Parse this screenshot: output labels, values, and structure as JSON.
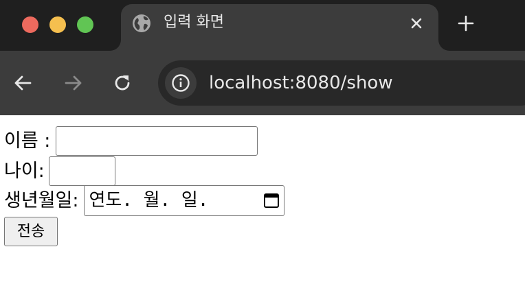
{
  "window": {
    "traffic_lights": {
      "close": "#ed6a5e",
      "minimize": "#f5bf4f",
      "maximize": "#61c554"
    }
  },
  "tab": {
    "title": "입력 화면",
    "favicon": "globe-icon",
    "close_icon": "close-icon"
  },
  "toolbar": {
    "back_icon": "arrow-left-icon",
    "forward_icon": "arrow-right-icon",
    "reload_icon": "reload-icon",
    "site_info_icon": "info-icon",
    "url": "localhost:8080/show",
    "new_tab_icon": "plus-icon"
  },
  "form": {
    "name_label": "이름 :",
    "name_value": "",
    "age_label": "나이:",
    "age_value": "",
    "birth_label": "생년월일:",
    "birth_placeholder": "연도. 월. 일.",
    "calendar_icon": "calendar-icon",
    "submit_label": "전송"
  },
  "colors": {
    "tab_strip": "#1f1f1f",
    "toolbar": "#3c3c3c",
    "omnibox": "#282828",
    "button_bg": "#efefef",
    "input_border": "#767676"
  }
}
